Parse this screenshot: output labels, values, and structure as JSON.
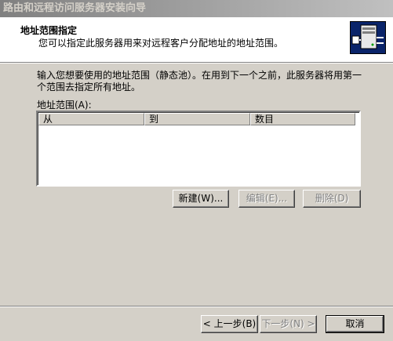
{
  "window": {
    "title": "路由和远程访问服务器安装向导"
  },
  "header": {
    "title": "地址范围指定",
    "subtitle": "您可以指定此服务器用来对远程客户分配地址的地址范围。",
    "icon": "server-network-icon"
  },
  "body": {
    "description": "输入您想要使用的地址范围（静态池）。在用到下一个之前，此服务器将用第一个范围去指定所有地址。",
    "range_label": "地址范围(A):",
    "table": {
      "columns": [
        "从",
        "到",
        "数目"
      ],
      "rows": []
    },
    "buttons": {
      "new": "新建(W)...",
      "edit": "编辑(E)...",
      "delete": "删除(D)"
    }
  },
  "footer": {
    "back": "< 上一步(B)",
    "next": "下一步(N) >",
    "cancel": "取消"
  },
  "colors": {
    "header_icon_bg": "#0a246a",
    "face": "#d4d0c8"
  }
}
